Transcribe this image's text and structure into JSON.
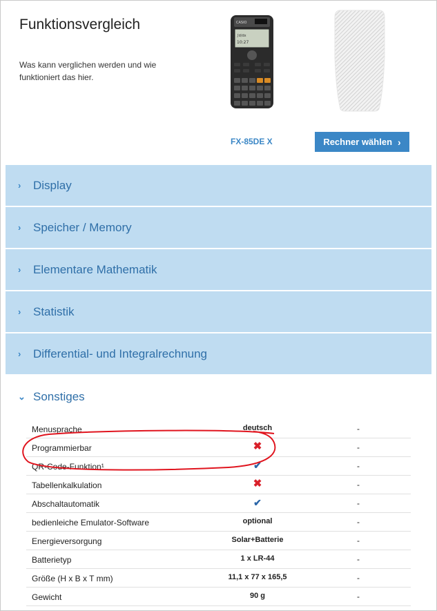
{
  "header": {
    "title": "Funktionsvergleich",
    "intro": "Was kann verglichen werden und wie funktioniert das hier.",
    "calculator_image": "casio-calculator-image",
    "placeholder_image": "calculator-placeholder-image",
    "model_name": "FX-85DE X",
    "choose_button": "Rechner wählen"
  },
  "accordion": [
    {
      "label": "Display"
    },
    {
      "label": "Speicher / Memory"
    },
    {
      "label": "Elementare Mathematik"
    },
    {
      "label": "Statistik"
    },
    {
      "label": "Differential- und Integralrechnung"
    }
  ],
  "open_section": {
    "label": "Sonstiges"
  },
  "rows": [
    {
      "name": "Menusprache",
      "value": "deutsch",
      "value_type": "text",
      "other": "-"
    },
    {
      "name": "Programmierbar",
      "value": "",
      "value_type": "cross-icon",
      "other": "-"
    },
    {
      "name": "QR-Code-Funktion¹",
      "value": "",
      "value_type": "check-icon",
      "other": "-"
    },
    {
      "name": "Tabellenkalkulation",
      "value": "",
      "value_type": "cross-icon",
      "other": "-"
    },
    {
      "name": "Abschaltautomatik",
      "value": "",
      "value_type": "check-icon",
      "other": "-"
    },
    {
      "name": "bedienleiche Emulator-Software",
      "value": "optional",
      "value_type": "text",
      "other": "-"
    },
    {
      "name": "Energieversorgung",
      "value": "Solar+Batterie",
      "value_type": "text",
      "other": "-"
    },
    {
      "name": "Batterietyp",
      "value": "1 x LR-44",
      "value_type": "text",
      "other": "-"
    },
    {
      "name": "Größe (H x B x T mm)",
      "value": "11,1 x 77 x 165,5",
      "value_type": "text",
      "other": "-"
    },
    {
      "name": "Gewicht",
      "value": "90 g",
      "value_type": "text",
      "other": "-"
    }
  ],
  "colors": {
    "accent": "#3b87c6",
    "accordion_bg": "#bfdcf1",
    "cross": "#d9202a",
    "check": "#2b66a8",
    "annotation": "#e0141e"
  }
}
